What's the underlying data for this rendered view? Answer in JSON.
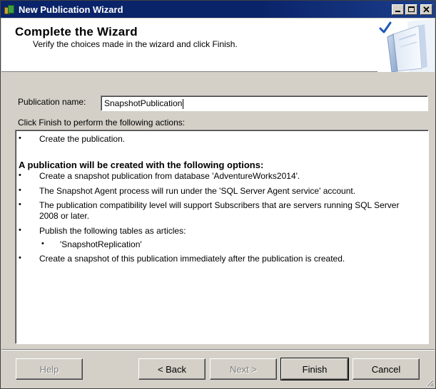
{
  "window": {
    "title": "New Publication Wizard"
  },
  "header": {
    "title": "Complete the Wizard",
    "subtitle": "Verify the choices made in the wizard and click Finish."
  },
  "form": {
    "publication_name_label": "Publication name:",
    "publication_name_value": "SnapshotPublication",
    "instructions": "Click Finish to perform the following actions:"
  },
  "actions": {
    "items_top": [
      "Create the publication."
    ],
    "heading": "A publication will be created with the following options:",
    "options": [
      "Create a snapshot publication from database 'AdventureWorks2014'.",
      "The Snapshot Agent process will run under the 'SQL Server Agent service' account.",
      "The publication compatibility level will support Subscribers that are servers running SQL Server 2008 or later.",
      "Publish the following tables as articles:"
    ],
    "articles": [
      "'SnapshotReplication'"
    ],
    "final_option": "Create a snapshot of this publication immediately after the publication is created."
  },
  "buttons": {
    "help": "Help",
    "back": "< Back",
    "next": "Next >",
    "finish": "Finish",
    "cancel": "Cancel"
  },
  "colors": {
    "titlebar": "#0a246a",
    "face": "#d4d0c8"
  }
}
